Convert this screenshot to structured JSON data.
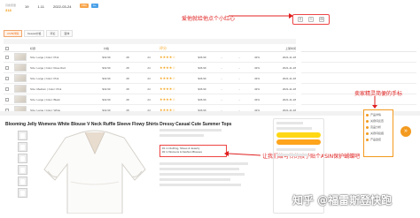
{
  "stats": [
    {
      "label": "月搜索量",
      "value": "318"
    },
    {
      "label": "",
      "value": "19"
    },
    {
      "label": "",
      "value": "1.11"
    },
    {
      "label": "",
      "value": "2022-03-24"
    }
  ],
  "badges": [
    "FBA",
    "A+"
  ],
  "toolbar": {
    "buttons": [
      "⚲",
      "≡",
      "⊞"
    ]
  },
  "annotations": {
    "toolbar_note": "爱他就给他点个小红心",
    "seller_note": "卖家精灵简便的手标",
    "asin_note": "让我们给可怜的孩子贴个ASIN保护蝴蝶吧"
  },
  "tabs": [
    {
      "label": "ASIN详情",
      "active": true
    },
    {
      "label": "Keepa价格",
      "active": false
    },
    {
      "label": "评论",
      "active": false
    },
    {
      "label": "变体",
      "active": false
    }
  ],
  "table": {
    "headers": [
      "",
      "",
      "标题",
      "价格",
      "",
      "",
      "评分",
      "",
      "",
      "",
      "",
      "上架时间"
    ],
    "rows": [
      {
        "title": "Size: Large | Color: Pink",
        "price": "$32.99",
        "a": "28",
        "b": "24",
        "stars": "★★★★☆",
        "c": "$36.99",
        "d": "...",
        "e": "...",
        "f": "43%",
        "date": "2021-11-18"
      },
      {
        "title": "Size: Large | Color: Rose Red",
        "price": "$32.99",
        "a": "28",
        "b": "24",
        "stars": "★★★★☆",
        "c": "$36.99",
        "d": "...",
        "e": "...",
        "f": "43%",
        "date": "2021-11-18"
      },
      {
        "title": "Size: Large | Color: Pink",
        "price": "$32.99",
        "a": "28",
        "b": "24",
        "stars": "★★★★☆",
        "c": "$36.99",
        "d": "...",
        "e": "...",
        "f": "43%",
        "date": "2021-11-18"
      },
      {
        "title": "Size: Medium | Color: Pink",
        "price": "$32.99",
        "a": "28",
        "b": "24",
        "stars": "★★★★☆",
        "c": "$36.99",
        "d": "...",
        "e": "...",
        "f": "43%",
        "date": "2021-11-18"
      },
      {
        "title": "Size: Large | Color: Black",
        "price": "$32.99",
        "a": "28",
        "b": "24",
        "stars": "★★★★☆",
        "c": "$36.99",
        "d": "...",
        "e": "...",
        "f": "43%",
        "date": "2021-11-18"
      },
      {
        "title": "Size: Large | Color: White",
        "price": "$32.99",
        "a": "28",
        "b": "24",
        "stars": "★★★★☆",
        "c": "$36.99",
        "d": "...",
        "e": "...",
        "f": "43%",
        "date": "2021-11-18"
      }
    ]
  },
  "product": {
    "title": "Blooming Jelly Womens White Blouse V Neck Ruffle Sleeve Flowy Shirts Dressy Casual Cute Summer Tops",
    "rank_lines": [
      "#1 in Clothing, Shoes & Jewelry",
      "#2 in Womens & Fashion Blouses"
    ]
  },
  "seller_menu": {
    "items": [
      "产品详情",
      "关键词反查",
      "竞品分析",
      "关键词挖掘",
      "产品监控"
    ],
    "fab_icon": "»"
  },
  "watermark": "知乎 @福雷斯登快跑",
  "colors": {
    "accent": "#f39a1e",
    "annotation": "#e02020"
  }
}
